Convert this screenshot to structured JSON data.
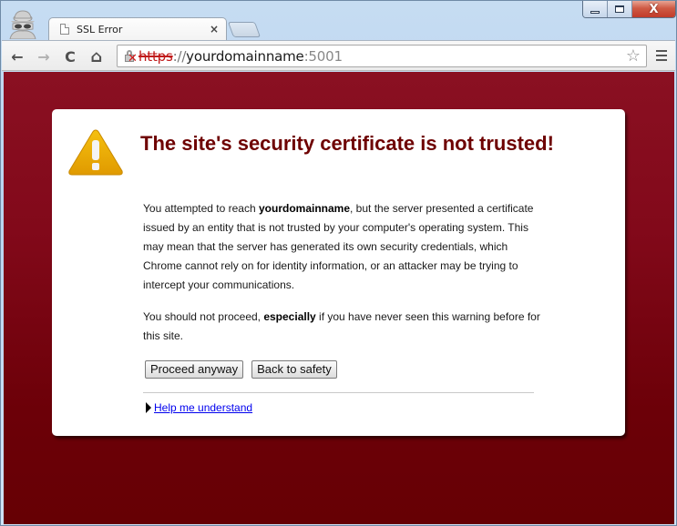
{
  "browser": {
    "tab": {
      "title": "SSL Error",
      "close_glyph": "×"
    },
    "window_controls": {
      "minimize": "minimize",
      "maximize": "maximize",
      "close": "X"
    },
    "nav": {
      "back": "←",
      "forward": "→",
      "reload": "C",
      "home": "⌂"
    },
    "address": {
      "scheme": "https",
      "separator": "://",
      "host": "yourdomainname",
      "port": ":5001",
      "security_state": "certificate-error"
    },
    "star_glyph": "☆"
  },
  "page": {
    "title": "The site's security certificate is not trusted!",
    "paragraph1": {
      "before": "You attempted to reach ",
      "bold": "yourdomainname",
      "after": ", but the server presented a certificate issued by an entity that is not trusted by your computer's operating system. This may mean that the server has generated its own security credentials, which Chrome cannot rely on for identity information, or an attacker may be trying to intercept your communications."
    },
    "paragraph2": {
      "before": "You should not proceed, ",
      "bold": "especially",
      "after": " if you have never seen this warning before for this site."
    },
    "buttons": {
      "proceed": "Proceed anyway",
      "back": "Back to safety"
    },
    "help_link": "Help me understand"
  },
  "colors": {
    "background_top": "#8a1022",
    "background_bottom": "#660004",
    "title": "#6e0000",
    "link": "#0000ee",
    "warning_icon": "#f0b400"
  }
}
